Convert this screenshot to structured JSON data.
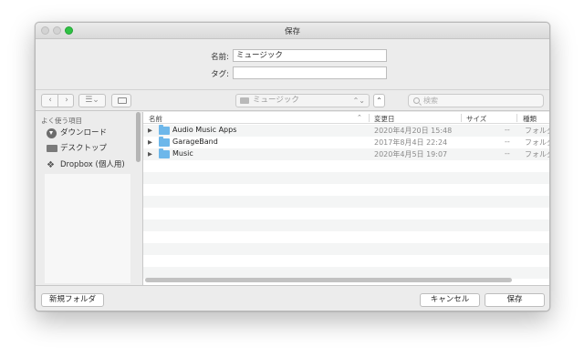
{
  "window": {
    "title": "保存"
  },
  "form": {
    "name_label": "名前:",
    "name_value": "ミュージック",
    "tags_label": "タグ:",
    "tags_value": ""
  },
  "toolbar": {
    "back_glyph": "‹",
    "forward_glyph": "›",
    "view_glyph": "☰",
    "view_chevron": "⌄",
    "location": "ミュージック",
    "location_arrows": "⌃⌄",
    "expand_glyph": "⌃",
    "search_placeholder": "検索"
  },
  "sidebar": {
    "heading": "よく使う項目",
    "items": [
      {
        "label": "ダウンロード",
        "icon": "download-icon"
      },
      {
        "label": "デスクトップ",
        "icon": "desktop-icon"
      },
      {
        "label": "Dropbox (個人用)",
        "icon": "dropbox-icon"
      }
    ]
  },
  "filelist": {
    "columns": {
      "name": "名前",
      "sort_glyph": "⌃",
      "modified": "変更日",
      "size": "サイズ",
      "kind": "種類"
    },
    "rows": [
      {
        "name": "Audio Music Apps",
        "modified": "2020年4月20日 15:48",
        "size": "--",
        "kind": "フォルダ"
      },
      {
        "name": "GarageBand",
        "modified": "2017年8月4日 22:24",
        "size": "--",
        "kind": "フォルダ"
      },
      {
        "name": "Music",
        "modified": "2020年4月5日 19:07",
        "size": "--",
        "kind": "フォルダ"
      }
    ]
  },
  "buttons": {
    "new_folder": "新規フォルダ",
    "cancel": "キャンセル",
    "save": "保存"
  },
  "colors": {
    "folder": "#6db7ea",
    "close_green": "#2fc244"
  }
}
